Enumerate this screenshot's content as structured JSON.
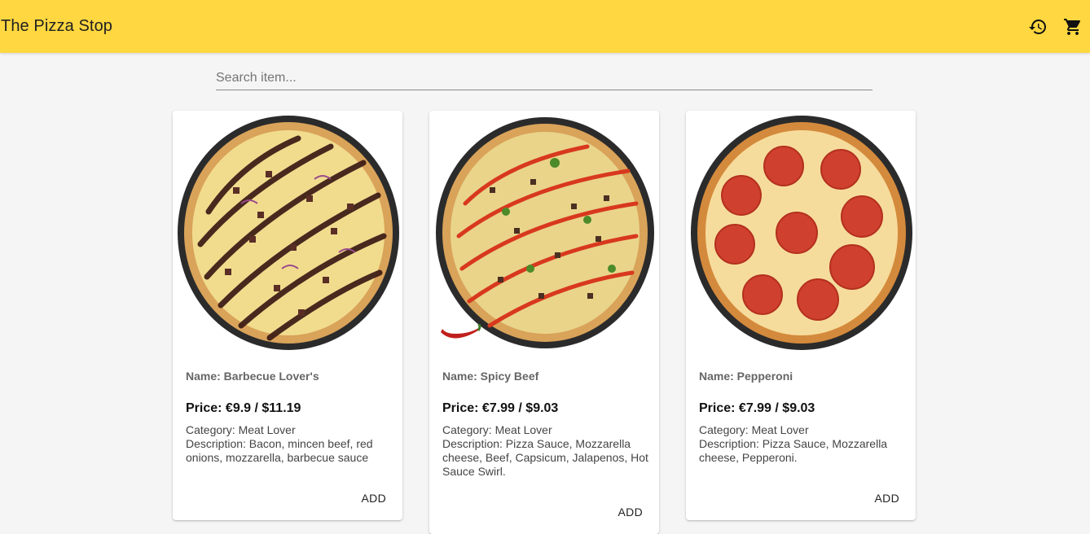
{
  "app": {
    "title": "The Pizza Stop",
    "accent_color": "#ffd740"
  },
  "toolbar": {
    "history_icon": "history-icon",
    "cart_icon": "cart-icon"
  },
  "search": {
    "placeholder": "Search item...",
    "value": ""
  },
  "products": [
    {
      "name": "Name: Barbecue Lover's",
      "price": "Price: €9.9 / $11.19",
      "category": "Category: Meat Lover",
      "description": "Description: Bacon, mincen beef, red onions, mozzarella, barbecue sauce",
      "add_label": "ADD",
      "image": "bbq-pizza"
    },
    {
      "name": "Name: Spicy Beef",
      "price": "Price: €7.99 / $9.03",
      "category": "Category: Meat Lover",
      "description": "Description: Pizza Sauce, Mozzarella cheese, Beef, Capsicum, Jalapenos, Hot Sauce Swirl.",
      "add_label": "ADD",
      "image": "spicy-beef-pizza",
      "badge_icon": "chili-icon"
    },
    {
      "name": "Name: Pepperoni",
      "price": "Price: €7.99 / $9.03",
      "category": "Category: Meat Lover",
      "description": "Description: Pizza Sauce, Mozzarella cheese, Pepperoni.",
      "add_label": "ADD",
      "image": "pepperoni-pizza"
    }
  ]
}
